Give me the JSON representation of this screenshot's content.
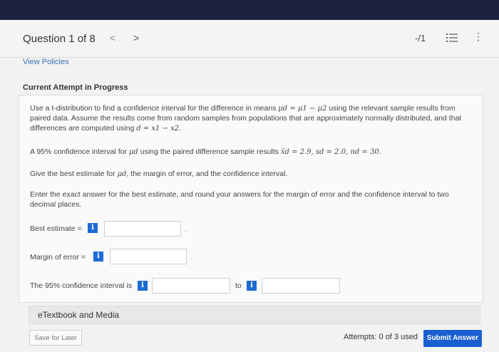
{
  "header": {
    "question_label": "Question 1 of 8",
    "prev_glyph": "<",
    "next_glyph": ">",
    "score": "-/1",
    "menu_glyph": "⋮"
  },
  "links": {
    "view_policies": "View Policies"
  },
  "attempt": {
    "heading": "Current Attempt in Progress"
  },
  "problem": {
    "p1_l1a": "Use a t-distribution to find a confidence interval for the difference in means",
    "p1_l1_math": "μd = μ1 − μ2",
    "p1_l1b": "using the relevant sample results from",
    "p1_l2": "paired data. Assume the results come from random samples from populations that are approximately normally distributed, and that",
    "p1_l3a": "differences are computed using",
    "p1_l3_math": "d = x1 − x2.",
    "p2a": "A 95% confidence interval for",
    "p2_math1": "μd",
    "p2b": "using the paired difference sample results",
    "p2_math2": "x̄d = 2.9, sd = 2.0, nd = 30.",
    "p3a": "Give the best estimate for",
    "p3_math": "μd",
    "p3b": ", the margin of error, and the confidence interval.",
    "p4_l1": "Enter the exact answer for the best estimate, and round your answers for the margin of error and the confidence interval to two",
    "p4_l2": "decimal places."
  },
  "form": {
    "best_estimate_label": "Best estimate =",
    "margin_label": "Margin of error =",
    "interval_label": "The 95% confidence interval is",
    "to_label": "to",
    "info_glyph": "i",
    "best_estimate_value": "",
    "margin_value": "",
    "interval_low_value": "",
    "interval_high_value": ""
  },
  "etextbook": {
    "label": "eTextbook and Media"
  },
  "footer": {
    "save_label": "Save for Later",
    "attempts": "Attempts: 0 of 3 used",
    "submit_label": "Submit Answer"
  },
  "colors": {
    "topbar": "#1c2340",
    "accent": "#1e6bd6",
    "submit": "#1a5fd1"
  },
  "icons": [
    "chevron-left-icon",
    "chevron-right-icon",
    "question-list-icon",
    "more-options-icon",
    "info-icon"
  ]
}
